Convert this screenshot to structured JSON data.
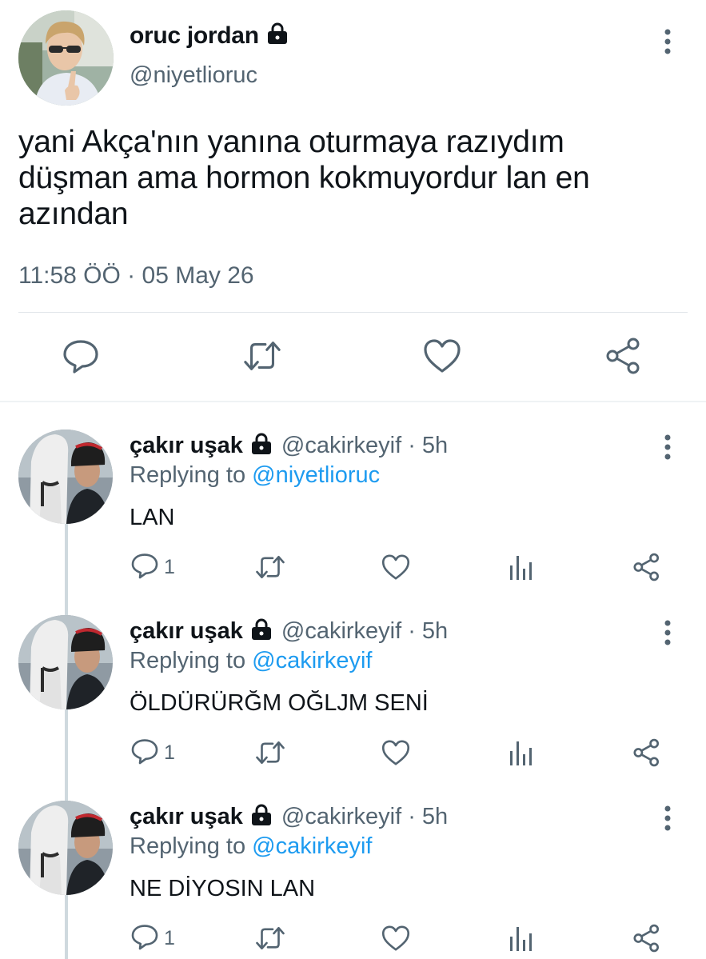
{
  "main_tweet": {
    "author_name": "oruc jordan",
    "author_handle": "@niyetlioruc",
    "text": "yani Akça'nın yanına oturmaya razıydım düşman ama hormon kokmuyordur lan en azından",
    "timestamp": "11:58 ÖÖ · 05 May 26",
    "icons": [
      "lock-icon",
      "more-vertical-icon",
      "reply-icon",
      "retweet-icon",
      "like-icon",
      "share-icon"
    ]
  },
  "replies": [
    {
      "author_name": "çakır uşak",
      "author_handle": "@cakirkeyif",
      "separator": "·",
      "time": "5h",
      "replying_label": "Replying to",
      "replying_to": "@niyetlioruc",
      "text": "LAN",
      "reply_count": "1"
    },
    {
      "author_name": "çakır uşak",
      "author_handle": "@cakirkeyif",
      "separator": "·",
      "time": "5h",
      "replying_label": "Replying to",
      "replying_to": "@cakirkeyif",
      "text": "ÖLDÜRÜRĞM OĞLJM SENİ",
      "reply_count": "1"
    },
    {
      "author_name": "çakır uşak",
      "author_handle": "@cakirkeyif",
      "separator": "·",
      "time": "5h",
      "replying_label": "Replying to",
      "replying_to": "@cakirkeyif",
      "text": "NE DİYOSIN LAN",
      "reply_count": "1"
    }
  ],
  "colors": {
    "text": "#0f1419",
    "secondary": "#536471",
    "link": "#1d9bf0",
    "divider": "#e1e6ea",
    "thread_line": "#cfd9de"
  }
}
